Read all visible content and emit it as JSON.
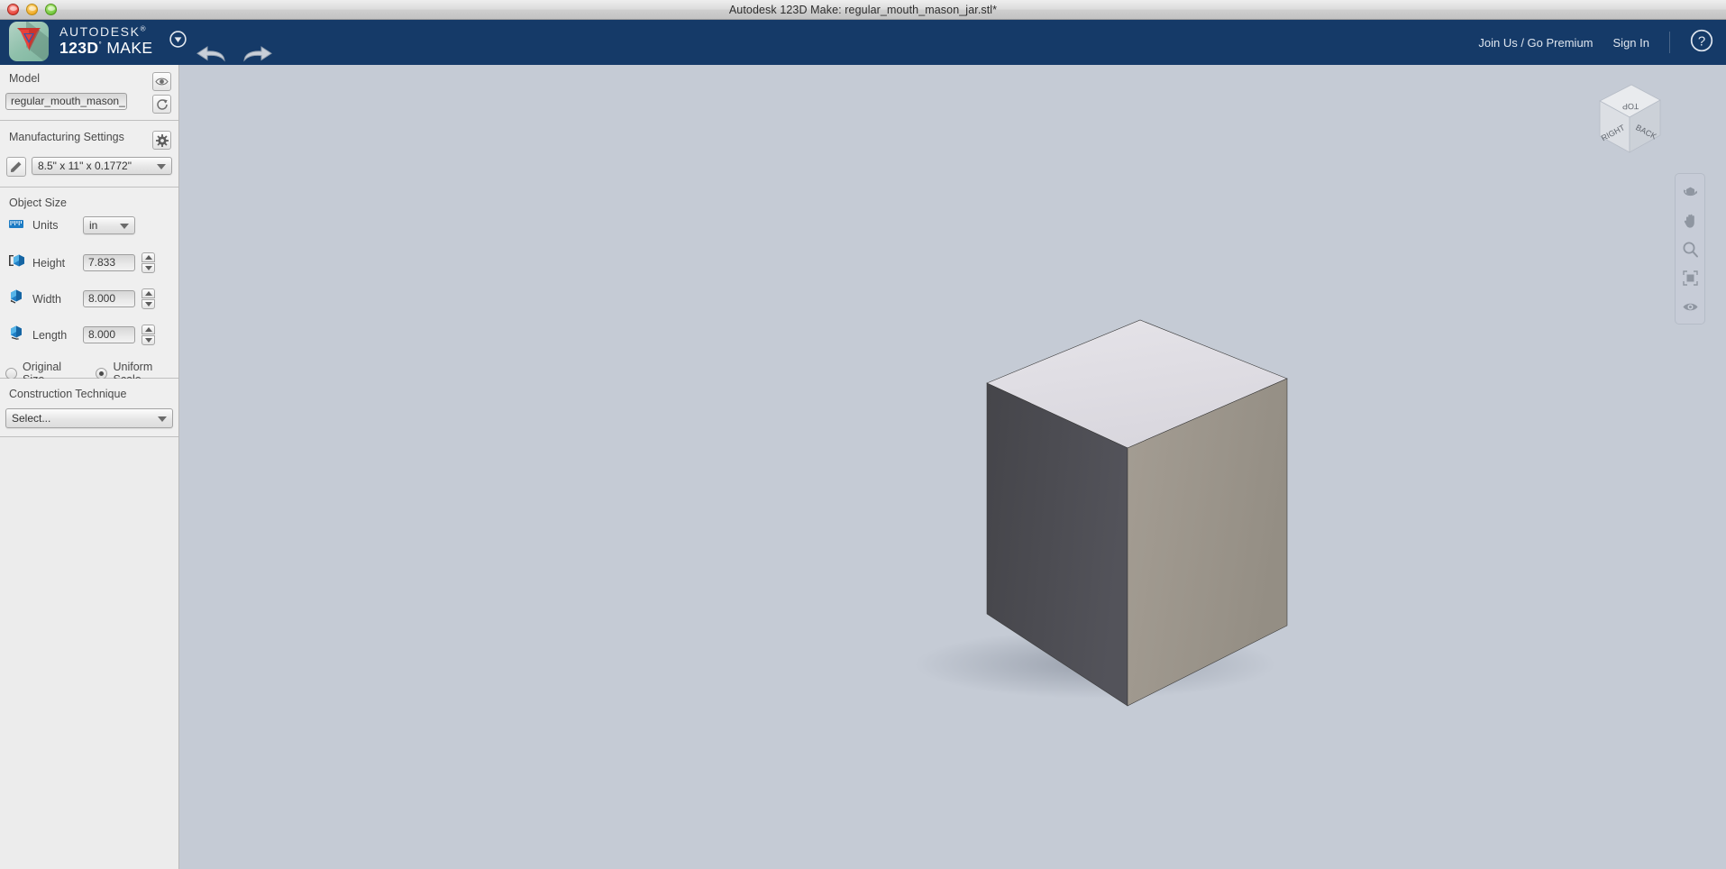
{
  "window": {
    "title": "Autodesk 123D Make: regular_mouth_mason_jar.stl*",
    "controls": {
      "close": "close-button",
      "minimize": "minimize-button",
      "zoom": "zoom-button"
    }
  },
  "appbar": {
    "brand_line1": "AUTODESK",
    "brand_trademark": "®",
    "brand_line2_bold": "123D",
    "brand_line2_sup": "°",
    "brand_line2_thin": "MAKE",
    "menu_caret": "menu-caret-icon",
    "undo": "undo-arrow-icon",
    "redo": "redo-arrow-icon",
    "join_label": "Join Us / Go Premium",
    "signin_label": "Sign In",
    "help_label": "?",
    "background_color": "#153a68"
  },
  "sidebar": {
    "model": {
      "title": "Model",
      "filename": "regular_mouth_mason_",
      "visibility_button": "eye-icon",
      "refresh_button": "refresh-icon"
    },
    "manufacturing": {
      "title": "Manufacturing Settings",
      "settings_button": "gear-icon",
      "edit_button": "pencil-icon",
      "material_size": "8.5\" x 11\" x 0.1772\""
    },
    "object_size": {
      "title": "Object Size",
      "units_label": "Units",
      "units_value": "in",
      "units_icon": "ruler-icon",
      "fields": [
        {
          "label": "Height",
          "value": "7.833",
          "icon": "height-cube-icon"
        },
        {
          "label": "Width",
          "value": "8.000",
          "icon": "width-cube-icon"
        },
        {
          "label": "Length",
          "value": "8.000",
          "icon": "length-cube-icon"
        }
      ],
      "scale_options": [
        {
          "label": "Original Size",
          "selected": false
        },
        {
          "label": "Uniform Scale",
          "selected": true
        }
      ]
    },
    "construction": {
      "title": "Construction Technique",
      "select_value": "Select..."
    }
  },
  "viewport": {
    "background_color": "#c5cbd5",
    "model": {
      "name": "cube-model",
      "top_face_color": "#e0dee3",
      "left_face_color": "#4b4b50",
      "right_face_color": "#9c968c"
    },
    "viewcube": {
      "name": "view-cube",
      "faces": {
        "top": "TOP",
        "left": "RIGHT",
        "right": "BACK"
      }
    },
    "nav_tools": [
      {
        "name": "orbit-icon",
        "label": "Orbit"
      },
      {
        "name": "pan-icon",
        "label": "Pan"
      },
      {
        "name": "zoom-icon",
        "label": "Zoom"
      },
      {
        "name": "fit-icon",
        "label": "Fit"
      },
      {
        "name": "look-icon",
        "label": "Look"
      }
    ]
  }
}
